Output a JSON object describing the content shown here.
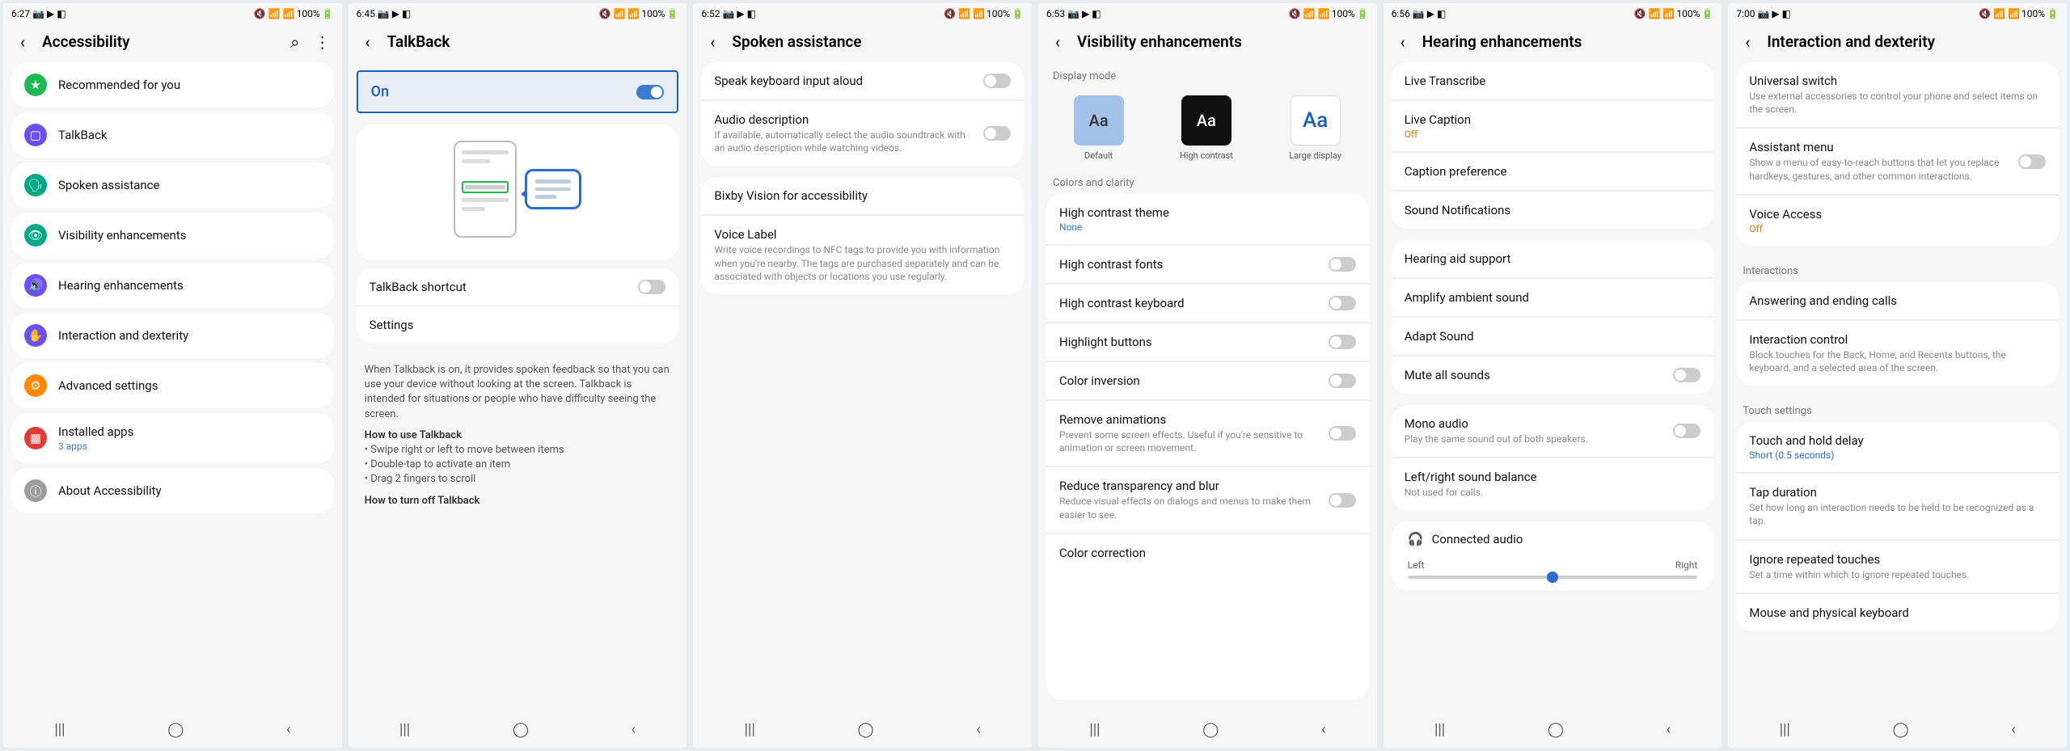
{
  "screens": [
    {
      "time": "6:27",
      "battery": "100%",
      "title": "Accessibility",
      "showSearch": true,
      "showMore": true,
      "items": [
        {
          "icon": "ic-green",
          "glyph": "★",
          "title": "Recommended for you"
        },
        {
          "icon": "ic-purple",
          "glyph": "▢",
          "title": "TalkBack"
        },
        {
          "icon": "ic-teal",
          "glyph": "🗣",
          "title": "Spoken assistance"
        },
        {
          "icon": "ic-teal",
          "glyph": "👁",
          "title": "Visibility enhancements"
        },
        {
          "icon": "ic-purple",
          "glyph": "🔊",
          "title": "Hearing enhancements"
        },
        {
          "icon": "ic-purple",
          "glyph": "✋",
          "title": "Interaction and dexterity"
        },
        {
          "icon": "ic-orange",
          "glyph": "⚙",
          "title": "Advanced settings"
        },
        {
          "icon": "ic-red",
          "glyph": "▦",
          "title": "Installed apps",
          "sub": "3 apps"
        },
        {
          "icon": "ic-gray",
          "glyph": "ⓘ",
          "title": "About Accessibility"
        }
      ]
    },
    {
      "time": "6:45",
      "battery": "100%",
      "title": "TalkBack",
      "masterToggle": {
        "label": "On",
        "on": true
      },
      "shortcut": {
        "title": "TalkBack shortcut"
      },
      "settings": {
        "title": "Settings"
      },
      "noteIntro": "When Talkback is on, it provides spoken feedback so that you can use your device without looking at the screen. Talkback is intended for situations or people who have difficulty seeing the screen.",
      "howToUse": "How to use Talkback",
      "bullets": [
        "• Swipe right or left to move between items",
        "• Double-tap to activate an item",
        "• Drag 2 fingers to scroll"
      ],
      "howToOff": "How to turn off Talkback"
    },
    {
      "time": "6:52",
      "battery": "100%",
      "title": "Spoken assistance",
      "rows": [
        {
          "title": "Speak keyboard input aloud",
          "toggle": true,
          "on": false
        },
        {
          "title": "Audio description",
          "desc": "If available, automatically select the audio soundtrack with an audio description while watching videos.",
          "toggle": true,
          "on": false
        },
        {
          "title": "Bixby Vision for accessibility"
        },
        {
          "title": "Voice Label",
          "desc": "Write voice recordings to NFC tags to provide you with information when you're nearby. The tags are purchased separately and can be associated with objects or locations you use regularly."
        }
      ]
    },
    {
      "time": "6:53",
      "battery": "100%",
      "title": "Visibility enhancements",
      "displayModeHeader": "Display mode",
      "modes": [
        {
          "class": "sw-default",
          "text": "Aa",
          "label": "Default"
        },
        {
          "class": "sw-contrast",
          "text": "Aa",
          "label": "High contrast"
        },
        {
          "class": "sw-large",
          "text": "Aa",
          "label": "Large display"
        }
      ],
      "colorsHeader": "Colors and clarity",
      "rows": [
        {
          "title": "High contrast theme",
          "sub": "None"
        },
        {
          "title": "High contrast fonts",
          "toggle": true
        },
        {
          "title": "High contrast keyboard",
          "toggle": true
        },
        {
          "title": "Highlight buttons",
          "toggle": true
        },
        {
          "title": "Color inversion",
          "toggle": true
        },
        {
          "title": "Remove animations",
          "desc": "Prevent some screen effects. Useful if you're sensitive to animation or screen movement.",
          "toggle": true
        },
        {
          "title": "Reduce transparency and blur",
          "desc": "Reduce visual effects on dialogs and menus to make them easier to see.",
          "toggle": true
        },
        {
          "title": "Color correction"
        }
      ]
    },
    {
      "time": "6:56",
      "battery": "100%",
      "title": "Hearing enhancements",
      "group1": [
        {
          "title": "Live Transcribe"
        },
        {
          "title": "Live Caption",
          "sub": "Off",
          "subClass": "off-orange"
        },
        {
          "title": "Caption preference"
        },
        {
          "title": "Sound Notifications"
        }
      ],
      "group2": [
        {
          "title": "Hearing aid support"
        },
        {
          "title": "Amplify ambient sound"
        },
        {
          "title": "Adapt Sound"
        },
        {
          "title": "Mute all sounds",
          "toggle": true
        }
      ],
      "group3": [
        {
          "title": "Mono audio",
          "desc": "Play the same sound out of both speakers.",
          "toggle": true
        },
        {
          "title": "Left/right sound balance",
          "desc": "Not used for calls."
        }
      ],
      "connected": "Connected audio",
      "slider": {
        "left": "Left",
        "right": "Right"
      }
    },
    {
      "time": "7:00",
      "battery": "100%",
      "title": "Interaction and dexterity",
      "group1": [
        {
          "title": "Universal switch",
          "desc": "Use external accessories to control your phone and select items on the screen."
        },
        {
          "title": "Assistant menu",
          "desc": "Show a menu of easy-to-reach buttons that let you replace hardkeys, gestures, and other common interactions.",
          "toggle": true
        },
        {
          "title": "Voice Access",
          "sub": "Off",
          "subClass": "off-orange"
        }
      ],
      "interactionsHeader": "Interactions",
      "group2": [
        {
          "title": "Answering and ending calls"
        },
        {
          "title": "Interaction control",
          "desc": "Block touches for the Back, Home, and Recents buttons, the keyboard, and a selected area of the screen."
        }
      ],
      "touchHeader": "Touch settings",
      "group3": [
        {
          "title": "Touch and hold delay",
          "sub": "Short (0.5 seconds)",
          "subClass": "blue"
        },
        {
          "title": "Tap duration",
          "desc": "Set how long an interaction needs to be held to be recognized as a tap."
        },
        {
          "title": "Ignore repeated touches",
          "desc": "Set a time within which to ignore repeated touches."
        },
        {
          "title": "Mouse and physical keyboard"
        }
      ]
    }
  ],
  "statusGlyphs": "📷 ▶ ◧",
  "signalGlyphs": "🔇 📶 📶"
}
